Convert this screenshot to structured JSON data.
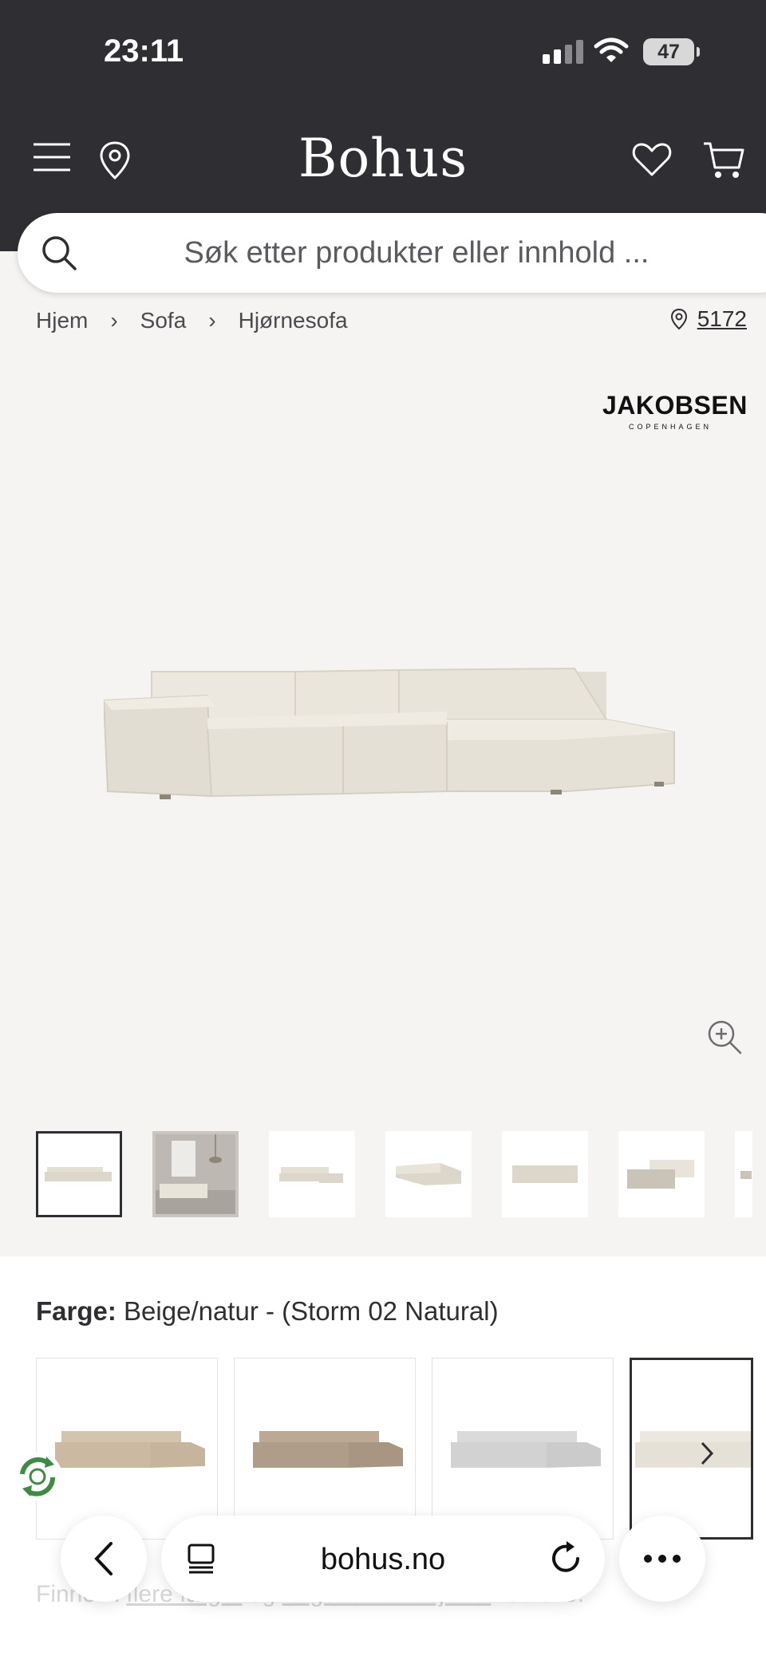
{
  "status_bar": {
    "time": "23:11",
    "battery": "47"
  },
  "header": {
    "logo": "Bohus"
  },
  "search": {
    "placeholder": "Søk etter produkter eller innhold ..."
  },
  "breadcrumb": {
    "items": [
      "Hjem",
      "Sofa",
      "Hjørnesofa"
    ]
  },
  "store": {
    "code": "5172"
  },
  "brand": {
    "name": "JAKOBSEN",
    "subtitle": "COPENHAGEN"
  },
  "color": {
    "label": "Farge:",
    "value": "Beige/natur - (Storm 02 Natural)"
  },
  "more_colors": {
    "prefix": "Finnes i ",
    "link1": "flere farger",
    "middle": " og ",
    "link2": "fargekombinasjoner",
    "suffix": ". Se alle."
  },
  "browser": {
    "url": "bohus.no"
  },
  "colors": {
    "header_bg": "#2f2e33",
    "page_bg": "#f5f4f2",
    "sofa_natural": "#e9e4da",
    "sofa_sand": "#cbb9a2",
    "sofa_taupe": "#b09d89",
    "sofa_grey": "#d2d2d2"
  }
}
